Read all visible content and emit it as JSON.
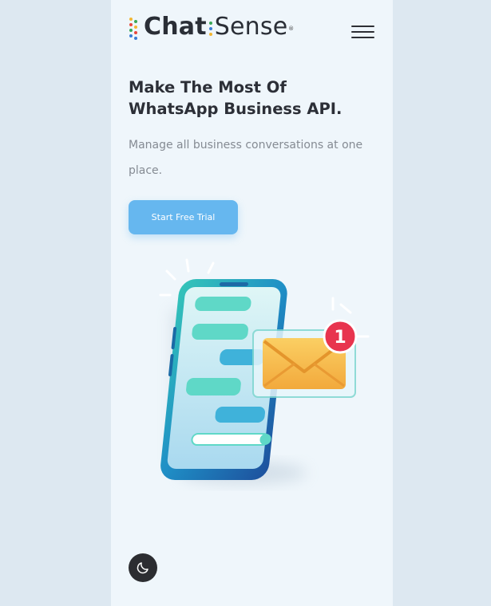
{
  "brand": {
    "name_part1": "Chat",
    "name_part2": "Sense",
    "registered": "®"
  },
  "header": {
    "menu_icon": "hamburger-menu-icon"
  },
  "hero": {
    "title": "Make The Most Of WhatsApp Business API.",
    "subtitle": "Manage all business conversations at one place.",
    "cta_label": "Start Free Trial"
  },
  "illustration": {
    "notification_count": "1",
    "icons": [
      "smartphone-chat-icon",
      "envelope-icon",
      "notification-badge-icon"
    ]
  },
  "theme_toggle": {
    "icon": "moon-icon"
  },
  "colors": {
    "accent": "#66b7ef",
    "badge": "#e8344e",
    "envelope": "#f6b94a",
    "phone": "#2aa5c4",
    "dark_text": "#2c2f37",
    "muted_text": "#858b93",
    "background": "#eff6fb",
    "outer_background": "#dde8f1"
  }
}
